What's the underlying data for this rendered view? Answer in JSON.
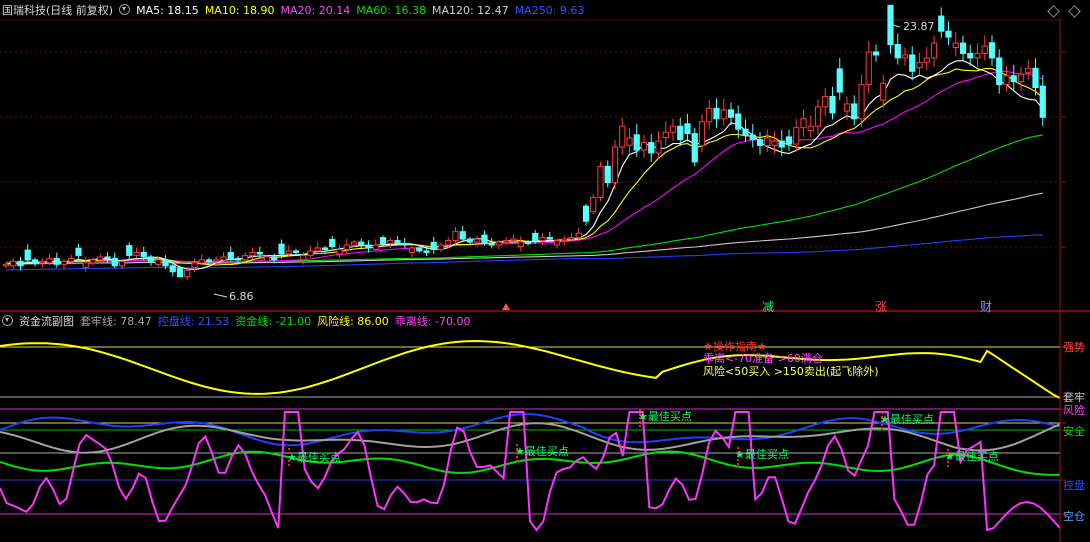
{
  "main_header": {
    "title": "国瑞科技(日线 前复权)",
    "ma5": "MA5: 18.15",
    "ma10": "MA10: 18.90",
    "ma20": "MA20: 20.14",
    "ma60": "MA60: 16.38",
    "ma120": "MA120: 12.47",
    "ma250": "MA250: 9.63"
  },
  "sub_header": {
    "title": "资金流副图",
    "taolao": "套牢线: 78.47",
    "kongpan": "控盘线: 21.53",
    "zijin": "资金线: -21.00",
    "fengxian": "风险线: 86.00",
    "chengli": "乖离线: -70.00"
  },
  "colors": {
    "up": "#ff3a3a",
    "down": "#54ffff",
    "ma5": "#ffffff",
    "ma10": "#ffff00",
    "ma20": "#ff00ff",
    "ma60": "#00e000",
    "ma120": "#c8c8c8",
    "ma250": "#2040ff",
    "taolao": "#a0a0a0",
    "kongpan": "#2040ff",
    "zijin": "#00e000",
    "fengxian": "#ffff00",
    "chengli": "#ff33ff"
  },
  "main_annotations": {
    "high_label": "23.87",
    "low_label": "6.86",
    "jian": "减",
    "zhang": "涨",
    "cai": "财"
  },
  "sub_annotations": {
    "guide_title": "★操作指南★",
    "guide_line1": "乖离<-70准备 >60满仓",
    "guide_line2": "风险<50买入 >150卖出(起飞除外)",
    "signals": [
      "★最佳买点",
      "★最佳买点",
      "★最佳买点",
      "★最佳买点",
      "★最佳买点",
      "★最佳买点"
    ]
  },
  "right_labels": {
    "qiangshi": "强势",
    "taolao": "套牢",
    "fengxian": "风险",
    "anquan": "安全",
    "kongpan": "控盘",
    "kongcang": "空仓"
  },
  "chart_data": [
    {
      "type": "candlestick",
      "title": "国瑞科技(日线 前复权)",
      "ylim": [
        5.5,
        25.5
      ],
      "high": 23.87,
      "low": 6.86,
      "series": [
        {
          "name": "MA5",
          "last": 18.15
        },
        {
          "name": "MA10",
          "last": 18.9
        },
        {
          "name": "MA20",
          "last": 20.14
        },
        {
          "name": "MA60",
          "last": 16.38
        },
        {
          "name": "MA120",
          "last": 12.47
        },
        {
          "name": "MA250",
          "last": 9.63
        }
      ],
      "ohlc_phase1": [
        7.7,
        7.9,
        7.6,
        8.0,
        7.8,
        7.9,
        8.1,
        7.7,
        7.9,
        8.1,
        8.3,
        7.8,
        8.0,
        8.2,
        8.1,
        7.6,
        7.9,
        8.3,
        8.5,
        8.2,
        7.9,
        8.0,
        7.6,
        7.2,
        6.86,
        7.3,
        7.8,
        8.0,
        7.9,
        8.0,
        8.2,
        8.1,
        8.0,
        8.3,
        8.5,
        8.4,
        8.2,
        8.0,
        8.4,
        8.6,
        8.5,
        8.3,
        8.6,
        8.8,
        8.7,
        8.9,
        8.7,
        9.0,
        9.2,
        9.0,
        8.8,
        9.0,
        9.1,
        9.3,
        9.1,
        9.0,
        8.8,
        8.6,
        8.5,
        8.7,
        9.0,
        9.3,
        9.9,
        9.4,
        9.2,
        9.4,
        9.1,
        9.0,
        9.2,
        9.3,
        9.4,
        9.2,
        9.1,
        9.3,
        9.5,
        9.4,
        9.3,
        9.4,
        9.5,
        9.8,
        10.6
      ],
      "closes_phase2": [
        12.2,
        14.3,
        13.2,
        15.6,
        17.0,
        16.2,
        15.4,
        15.9,
        15.2,
        16.0,
        16.6,
        17.0,
        16.1,
        16.5,
        14.6,
        17.3,
        18.2,
        17.5,
        18.1,
        17.6,
        16.8,
        16.4,
        16.1,
        15.7,
        16.2,
        16.0,
        15.6,
        15.8,
        16.9,
        17.5,
        17.0,
        18.3,
        19.0,
        17.9,
        19.3,
        18.5,
        17.5,
        19.8,
        22.0,
        21.8,
        19.9,
        22.5,
        21.6,
        21.8,
        20.7,
        21.3,
        21.6,
        22.6,
        23.4,
        23.0,
        22.6,
        21.9,
        21.6,
        21.9,
        22.4,
        21.6,
        19.8,
        20.4,
        20.0,
        20.5,
        20.9,
        19.6,
        17.6
      ]
    },
    {
      "type": "line",
      "title": "资金流副图",
      "series": [
        {
          "name": "套牢线",
          "last": 78.47
        },
        {
          "name": "控盘线",
          "last": 21.53
        },
        {
          "name": "资金线",
          "last": -21.0
        },
        {
          "name": "风险线",
          "last": 86.0
        },
        {
          "name": "乖离线",
          "last": -70.0
        }
      ],
      "levels": [
        "强势",
        "套牢",
        "风险",
        "安全",
        "控盘",
        "空仓"
      ]
    }
  ]
}
